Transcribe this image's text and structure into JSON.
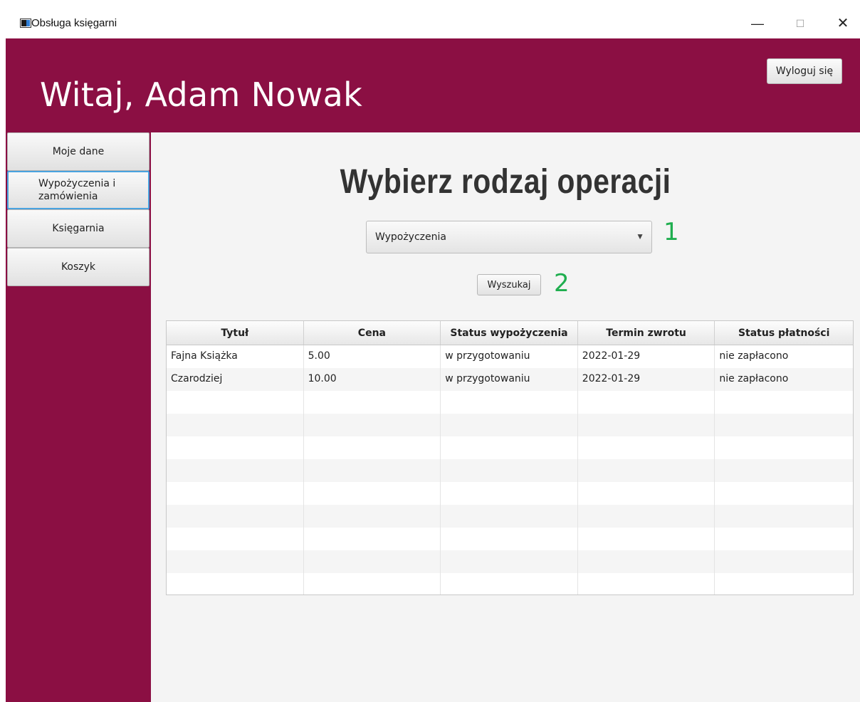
{
  "window": {
    "title": "Obsługa księgarni",
    "minimize_label": "—",
    "maximize_label": "☐",
    "close_label": "✕"
  },
  "header": {
    "greeting": "Witaj, Adam Nowak",
    "logout_label": "Wyloguj się",
    "background": "#8b0f43"
  },
  "sidebar": {
    "items": [
      {
        "label": "Moje dane"
      },
      {
        "label": "Wypożyczenia i zamówienia",
        "line1": "Wypożyczenia i",
        "line2": "zamówienia",
        "selected": true
      },
      {
        "label": "Księgarnia"
      },
      {
        "label": "Koszyk"
      }
    ]
  },
  "main": {
    "title": "Wybierz rodzaj operacji",
    "operation_select": {
      "value": "Wypożyczenia"
    },
    "step1": "1",
    "search_label": "Wyszukaj",
    "step2": "2",
    "step_color": "#1fae4f"
  },
  "table": {
    "columns": [
      "Tytuł",
      "Cena",
      "Status wypożyczenia",
      "Termin zwrotu",
      "Status płatności"
    ],
    "rows": [
      [
        "Fajna Książka",
        "5.00",
        "w przygotowaniu",
        "2022-01-29",
        "nie zapłacono"
      ],
      [
        "Czarodziej",
        "10.00",
        "w przygotowaniu",
        "2022-01-29",
        "nie zapłacono"
      ]
    ]
  }
}
